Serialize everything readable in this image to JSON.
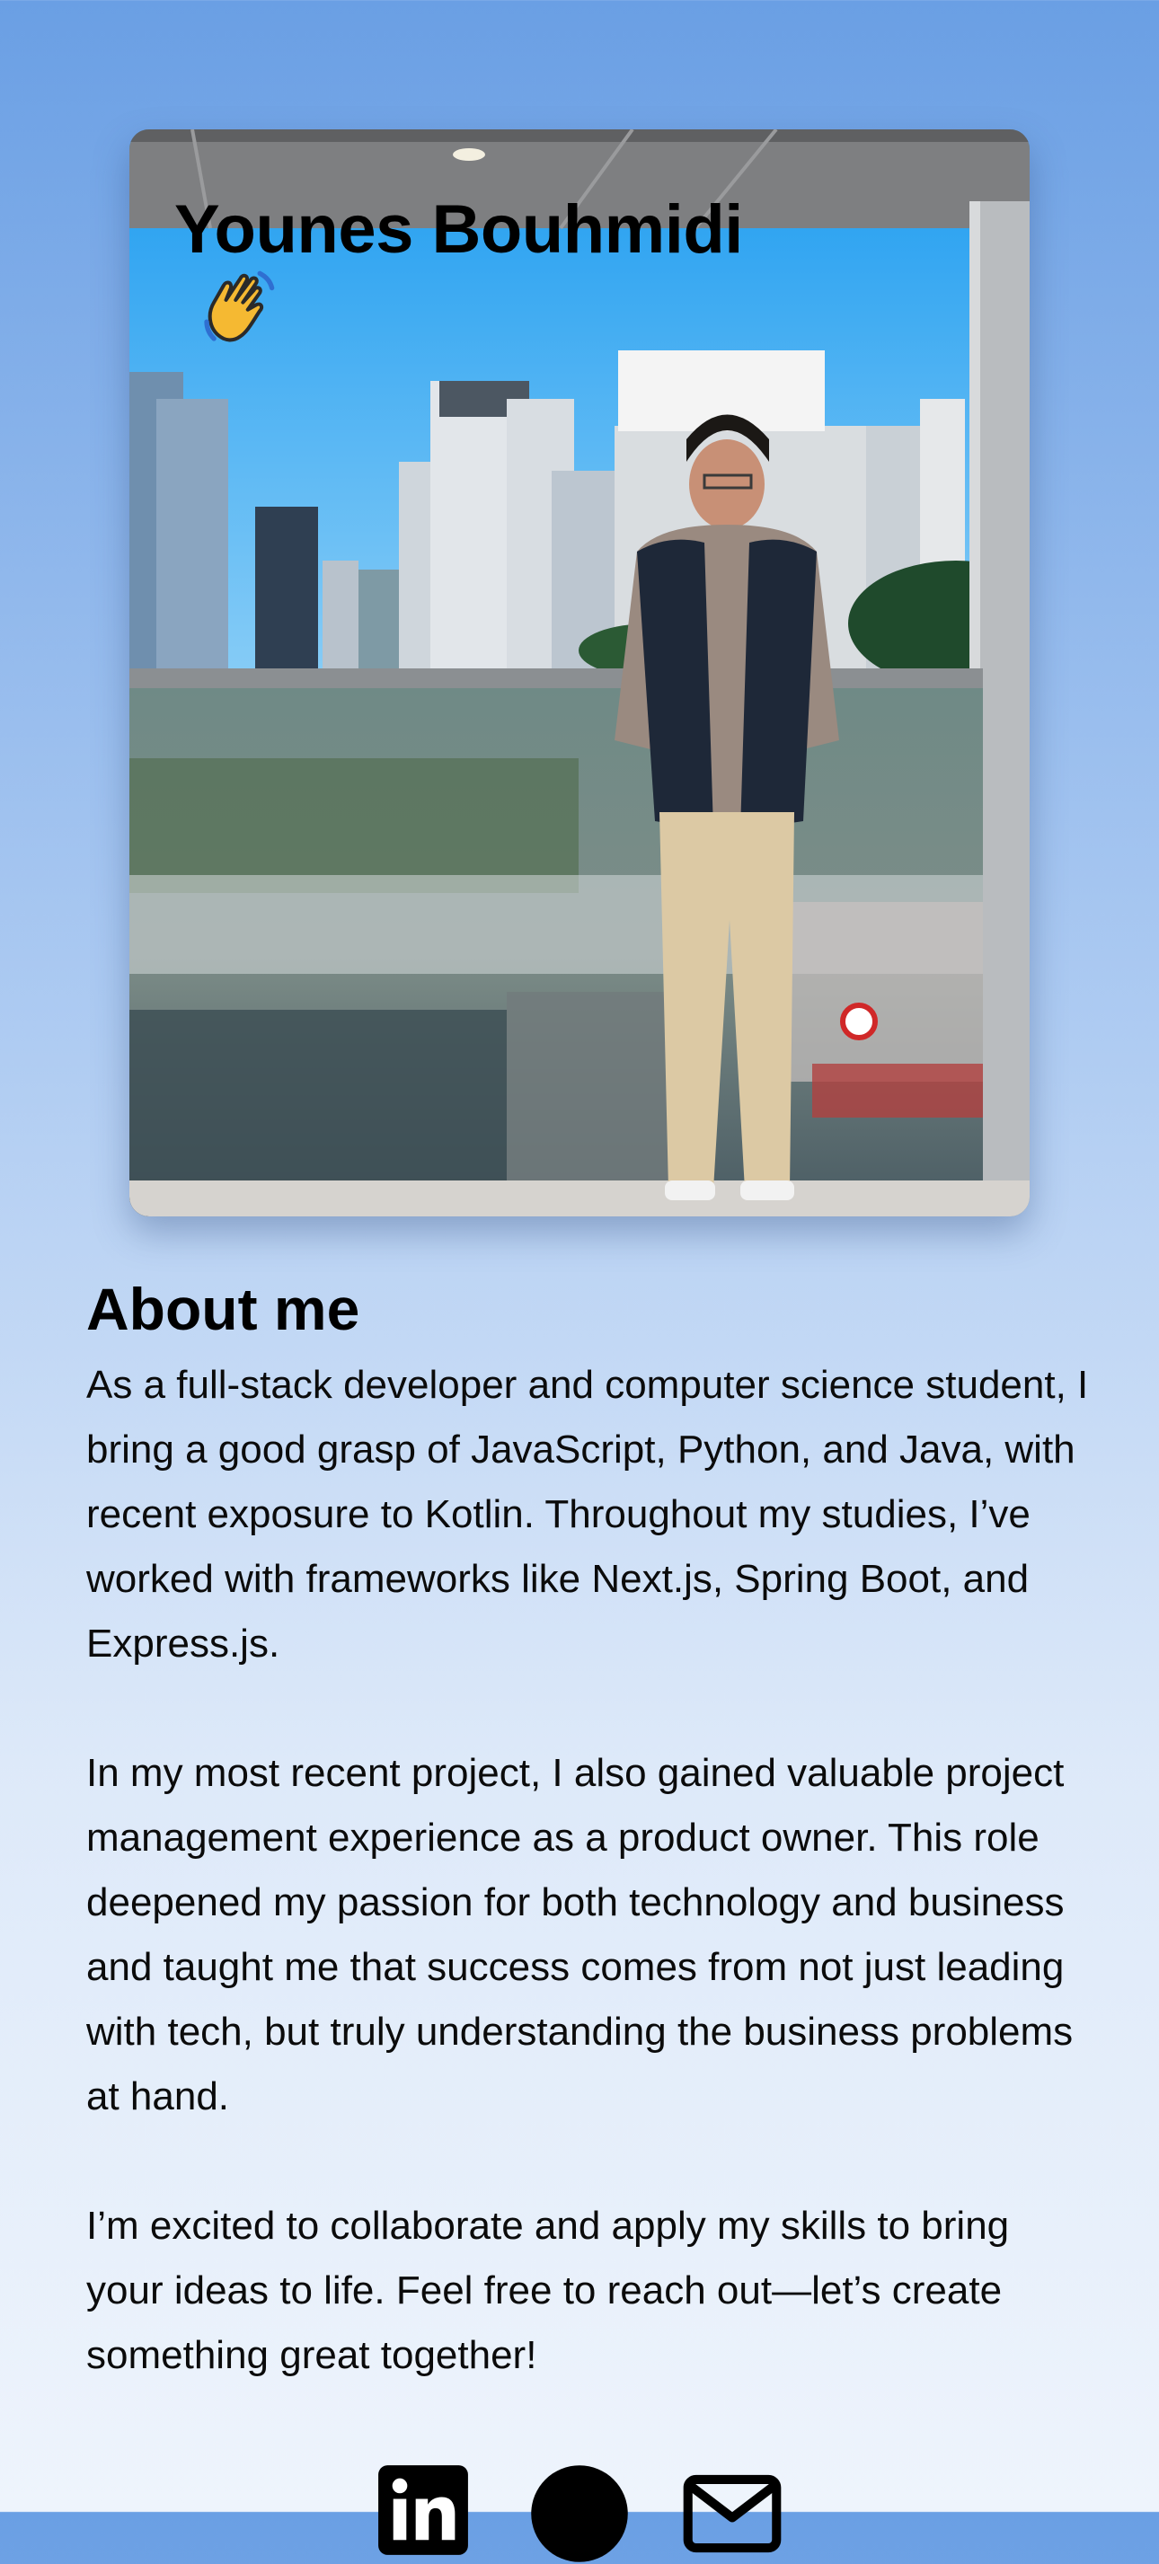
{
  "profile": {
    "name": "Younes Bouhmidi",
    "greeting_icon": "waving-hand-icon"
  },
  "about": {
    "heading": "About me",
    "paragraphs": [
      "As a full-stack developer and computer science student, I bring a good grasp of JavaScript, Python, and Java, with recent exposure to Kotlin. Throughout my studies, I’ve worked with frameworks like Next.js, Spring Boot, and Express.js.",
      "In my most recent project, I also gained valuable project management experience as a product owner. This role deepened my passion for both technology and business and taught me that success comes from not just leading with tech, but truly understanding the business problems at hand.",
      "I’m excited to collaborate and apply my skills to bring your ideas to life. Feel free to reach out—let’s create something great together!"
    ]
  },
  "social": {
    "items": [
      {
        "icon": "linkedin-icon"
      },
      {
        "icon": "github-icon"
      },
      {
        "icon": "mail-icon"
      }
    ]
  },
  "colors": {
    "background_top": "#6a9fe4",
    "background_bottom": "#eef4fc",
    "text": "#000000"
  }
}
